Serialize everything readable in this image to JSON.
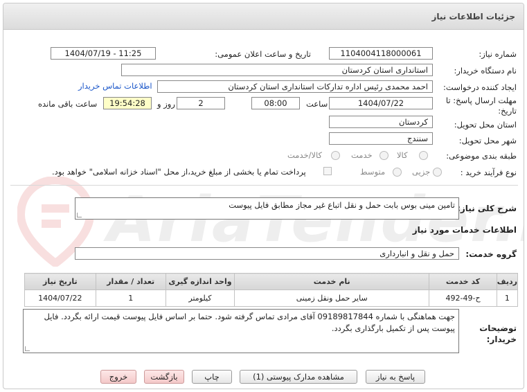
{
  "header": {
    "title": "جزئیات اطلاعات نیاز"
  },
  "fields": {
    "need_number_label": "شماره نیاز:",
    "need_number": "1104004118000061",
    "announce_label": "تاریخ و ساعت اعلان عمومی:",
    "announce_value": "1404/07/19 - 11:25",
    "buyer_org_label": "نام دستگاه خریدار:",
    "buyer_org": "استانداری استان کردستان",
    "creator_label": "ایجاد کننده درخواست:",
    "creator": "احمد محمدی رئیس اداره تدارکات استانداری استان کردستان",
    "contact_link": "اطلاعات تماس خریدار",
    "deadline_label": "مهلت ارسال پاسخ: تا تاریخ:",
    "deadline_date": "1404/07/22",
    "time_label": "ساعت",
    "deadline_time": "08:00",
    "days_value": "2",
    "days_label": "روز و",
    "remaining_time": "19:54:28",
    "remaining_label": "ساعت باقی مانده",
    "province_label": "استان محل تحویل:",
    "province": "کردستان",
    "city_label": "شهر محل تحویل:",
    "city": "سنندج",
    "category_label": "طبقه بندی موضوعی:",
    "category_options": [
      "کالا",
      "خدمت",
      "کالا/خدمت"
    ],
    "process_label": "نوع فرآیند خرید :",
    "process_options": [
      "جزیی",
      "متوسط"
    ],
    "payment_text": "پرداخت تمام یا بخشی از مبلغ خرید،از محل \"اسناد خزانه اسلامی\" خواهد بود."
  },
  "summary": {
    "label": "شرح کلی نیاز:",
    "text": "تامین مینی بوس بابت حمل و نقل اتباع غیر مجاز مطابق فایل پیوست"
  },
  "services": {
    "section_title": "اطلاعات خدمات مورد نیاز",
    "group_label": "گروه خدمت:",
    "group_value": "حمل و نقل و انبارداری",
    "columns": [
      "ردیف",
      "کد خدمت",
      "نام خدمت",
      "واحد اندازه گیری",
      "تعداد / مقدار",
      "تاریخ نیاز"
    ],
    "rows": [
      [
        "1",
        "ح-49-492",
        "سایر حمل ونقل زمینی",
        "کیلومتر",
        "1",
        "1404/07/22"
      ]
    ]
  },
  "notes": {
    "label": "توضیحات خریدار:",
    "text": "جهت هماهنگی با شماره 09189817844 آقای مرادی تماس گرفته شود. حتما بر اساس فایل پیوست قیمت ارائه بگردد. فایل پیوست پس از تکمیل بارگذاری بگردد."
  },
  "buttons": {
    "reply": "پاسخ به نیاز",
    "attachments": "مشاهده مدارک پیوستی (1)",
    "print": "چاپ",
    "back": "بازگشت",
    "exit": "خروج"
  },
  "watermark": {
    "text": "AriaTender.neT"
  }
}
